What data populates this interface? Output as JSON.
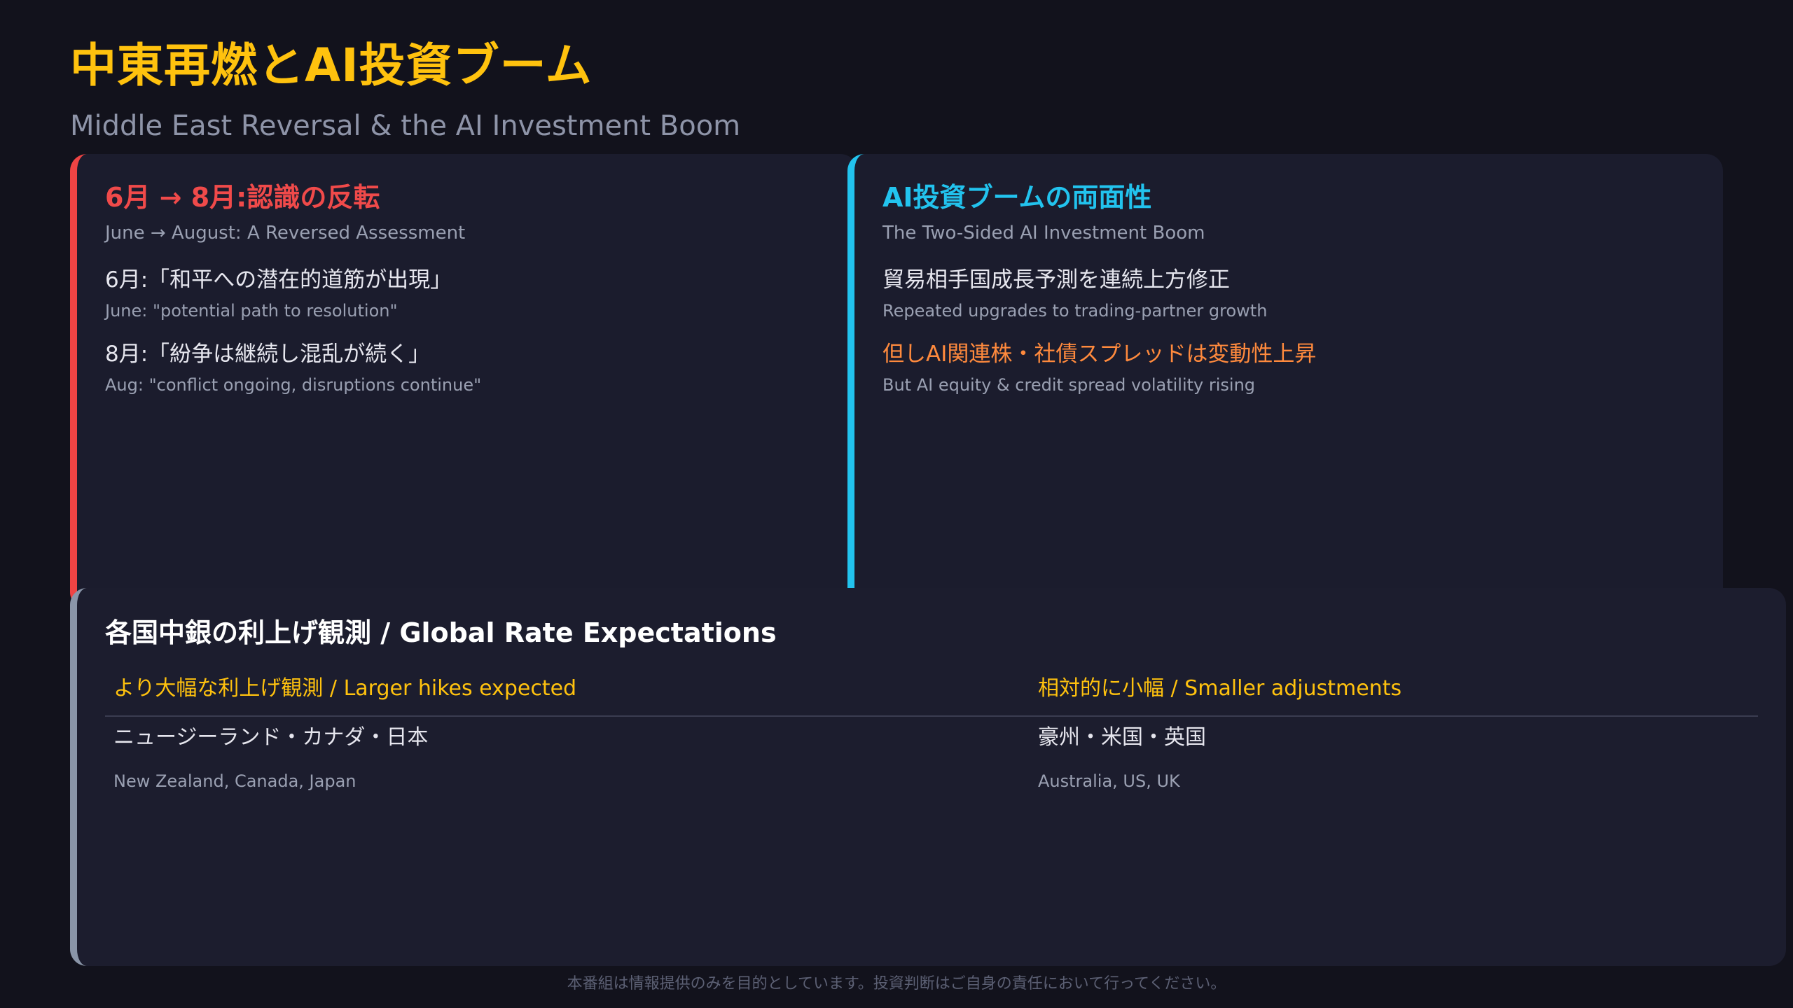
{
  "header": {
    "title": "中東再燃とAI投資ブーム",
    "subtitle": "Middle East Reversal & the AI Investment Boom"
  },
  "left_card": {
    "title": "6月 → 8月:認識の反転",
    "subtitle": "June → August: A Reversed Assessment",
    "accent_color": "#ef4444",
    "items": [
      {
        "main": "6月:「和平への潜在的道筋が出現」",
        "sub": "June: \"potential path to resolution\""
      },
      {
        "main": "8月:「紛争は継続し混乱が続く」",
        "sub": "Aug: \"conflict ongoing, disruptions continue\""
      }
    ]
  },
  "right_card": {
    "title": "AI投資ブームの両面性",
    "subtitle": "The Two-Sided AI Investment Boom",
    "accent_color": "#22c3ee",
    "items": [
      {
        "main": "貿易相手国成長予測を連続上方修正",
        "sub": "Repeated upgrades to trading-partner growth"
      },
      {
        "main": "但しAI関連株・社債スプレッドは変動性上昇",
        "sub": "But AI equity & credit spread volatility rising"
      }
    ]
  },
  "bottom_card": {
    "title": "各国中銀の利上げ観測 / Global Rate Expectations",
    "accent_color": "#8a95a8",
    "columns": [
      {
        "header": "より大幅な利上げ観測 / Larger hikes expected",
        "main": "ニュージーランド・カナダ・日本",
        "sub": "New Zealand, Canada, Japan"
      },
      {
        "header": "相対的に小幅 / Smaller adjustments",
        "main": "豪州・米国・英国",
        "sub": "Australia, US, UK"
      }
    ]
  },
  "footer": {
    "disclaimer": "本番組は情報提供のみを目的としています。投資判断はご自身の責任において行ってください。"
  },
  "colors": {
    "background": "#12121c",
    "title": "#ffc20e",
    "highlight": "#ff8a3d"
  }
}
